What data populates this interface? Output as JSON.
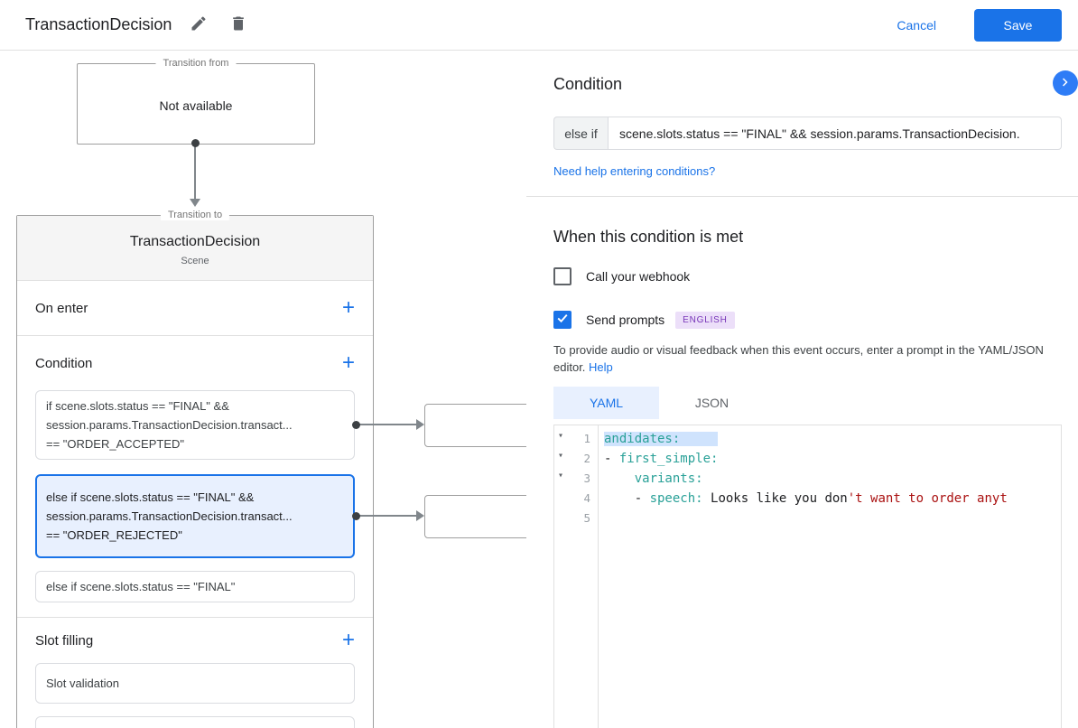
{
  "topbar": {
    "title": "TransactionDecision",
    "cancel_label": "Cancel",
    "save_label": "Save"
  },
  "canvas": {
    "transition_from": {
      "label": "Transition from",
      "content": "Not available"
    },
    "transition_to": {
      "label": "Transition to",
      "title": "TransactionDecision",
      "subtitle": "Scene",
      "on_enter_label": "On enter",
      "condition_label": "Condition",
      "slot_filling_label": "Slot filling",
      "condition_cards": [
        {
          "selected": false,
          "lines": [
            "if scene.slots.status == \"FINAL\" &&",
            "session.params.TransactionDecision.transact...",
            "== \"ORDER_ACCEPTED\""
          ]
        },
        {
          "selected": true,
          "lines": [
            "else if scene.slots.status == \"FINAL\" &&",
            "session.params.TransactionDecision.transact...",
            "== \"ORDER_REJECTED\""
          ]
        },
        {
          "selected": false,
          "lines": [
            "else if scene.slots.status == \"FINAL\""
          ]
        }
      ],
      "slot_cards": [
        {
          "label": "Slot validation"
        }
      ]
    }
  },
  "panel": {
    "heading": "Condition",
    "condition_operator": "else if",
    "condition_expression": "scene.slots.status == \"FINAL\" && session.params.TransactionDecision.",
    "help_link": "Need help entering conditions?",
    "when_met_heading": "When this condition is met",
    "webhook": {
      "label": "Call your webhook",
      "checked": false
    },
    "send_prompts": {
      "label": "Send prompts",
      "checked": true,
      "badge": "ENGLISH"
    },
    "hint_text": "To provide audio or visual feedback when this event occurs, enter a prompt in the YAML/JSON editor.",
    "hint_link": "Help",
    "tabs": [
      {
        "label": "YAML",
        "active": true
      },
      {
        "label": "JSON",
        "active": false
      }
    ],
    "editor": {
      "lines": [
        {
          "num": 1,
          "fold": true,
          "selected": true,
          "tokens": [
            {
              "t": "andidates:",
              "c": "key"
            }
          ]
        },
        {
          "num": 2,
          "fold": true,
          "selected": false,
          "tokens": [
            {
              "t": "- ",
              "c": "plain"
            },
            {
              "t": "first_simple:",
              "c": "key"
            }
          ]
        },
        {
          "num": 3,
          "fold": true,
          "selected": false,
          "tokens": [
            {
              "t": "    ",
              "c": "plain"
            },
            {
              "t": "variants:",
              "c": "key"
            }
          ]
        },
        {
          "num": 4,
          "fold": false,
          "selected": false,
          "tokens": [
            {
              "t": "    - ",
              "c": "plain"
            },
            {
              "t": "speech:",
              "c": "key"
            },
            {
              "t": " Looks like you don",
              "c": "plain"
            },
            {
              "t": "'t want to order anyt",
              "c": "string"
            }
          ]
        },
        {
          "num": 5,
          "fold": false,
          "selected": false,
          "tokens": []
        }
      ]
    }
  },
  "icons": {
    "edit-icon": "pencil",
    "delete-icon": "trash",
    "add-icon": "+",
    "collapse-panel-icon": "chevron-right",
    "fold-icon": "▾",
    "checkmark-icon": "✓"
  },
  "colors": {
    "accent": "#1a73e8",
    "selected_card_bg": "#e8f0fe",
    "badge_bg": "#ecdff9",
    "badge_text": "#7735b8",
    "code_key": "#2aa198",
    "code_string": "#aa1111",
    "code_selection": "#cfe3fd"
  }
}
